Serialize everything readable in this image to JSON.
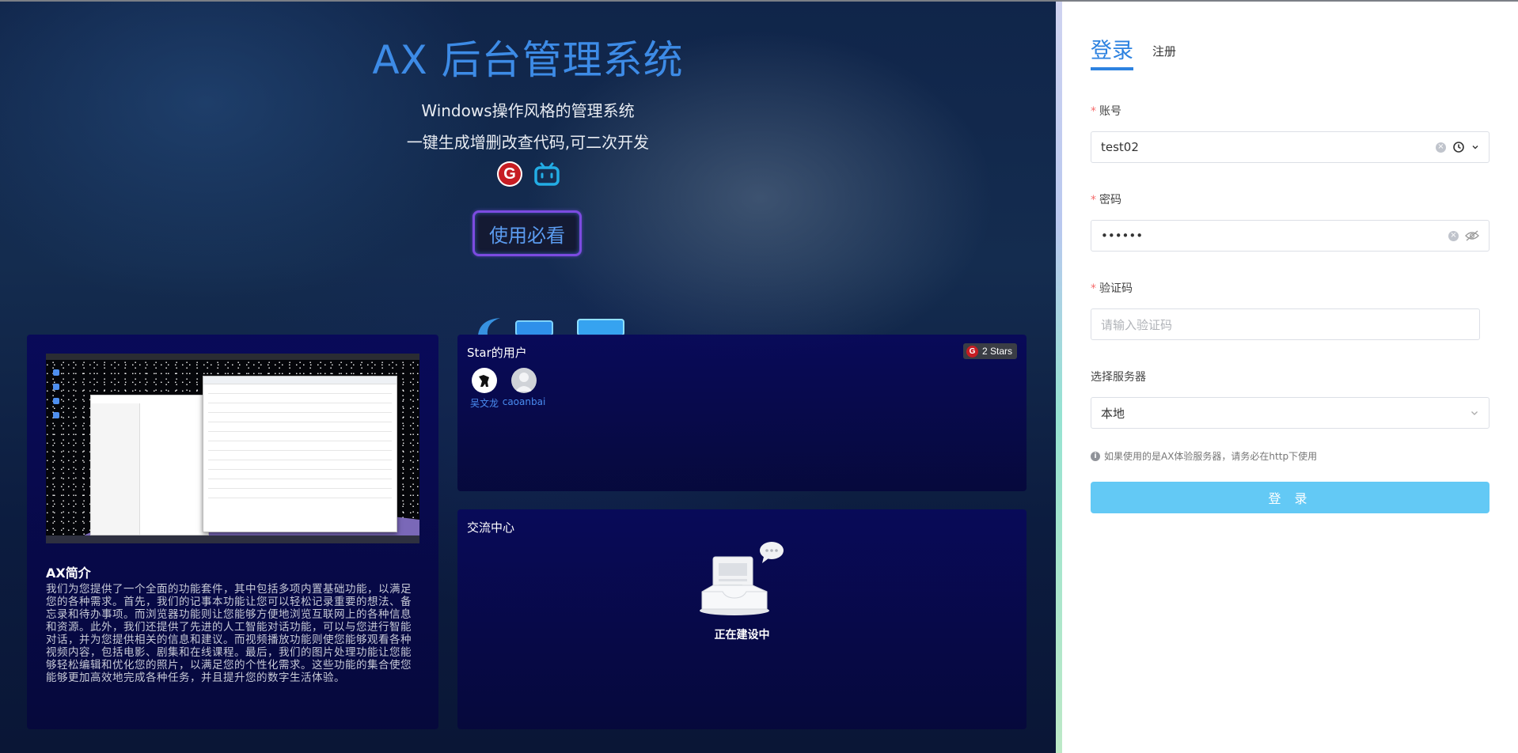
{
  "hero": {
    "title": "AX 后台管理系统",
    "subtitle1": "Windows操作风格的管理系统",
    "subtitle2": "一键生成增删改查代码,可二次开发",
    "icons": [
      "gitee-icon",
      "bilibili-icon"
    ],
    "guide_button": "使用必看",
    "accent_color": "#3d8be6"
  },
  "intro_card": {
    "title": "AX简介",
    "text": "我们为您提供了一个全面的功能套件，其中包括多项内置基础功能，以满足您的各种需求。首先，我们的记事本功能让您可以轻松记录重要的想法、备忘录和待办事项。而浏览器功能则让您能够方便地浏览互联网上的各种信息和资源。此外，我们还提供了先进的人工智能对话功能，可以与您进行智能对话，并为您提供相关的信息和建议。而视频播放功能则使您能够观看各种视频内容，包括电影、剧集和在线课程。最后，我们的图片处理功能让您能够轻松编辑和优化您的照片，以满足您的个性化需求。这些功能的集合使您能够更加高效地完成各种任务，并且提升您的数字生活体验。"
  },
  "star_card": {
    "title": "Star的用户",
    "badge": "2 Stars",
    "users": [
      {
        "name": "吴文龙"
      },
      {
        "name": "caoanbai"
      }
    ]
  },
  "community_card": {
    "title": "交流中心",
    "empty_text": "正在建设中"
  },
  "login": {
    "tabs": [
      {
        "label": "登录",
        "active": true
      },
      {
        "label": "注册",
        "active": false
      }
    ],
    "account_label": "账号",
    "account_value": "test02",
    "password_label": "密码",
    "password_value": "••••••",
    "captcha_label": "验证码",
    "captcha_placeholder": "请输入验证码",
    "server_label": "选择服务器",
    "server_value": "本地",
    "hint": "如果使用的是AX体验服务器，请务必在http下使用",
    "submit": "登 录",
    "button_color": "#63c9f5",
    "tab_color": "#2d82e0"
  }
}
